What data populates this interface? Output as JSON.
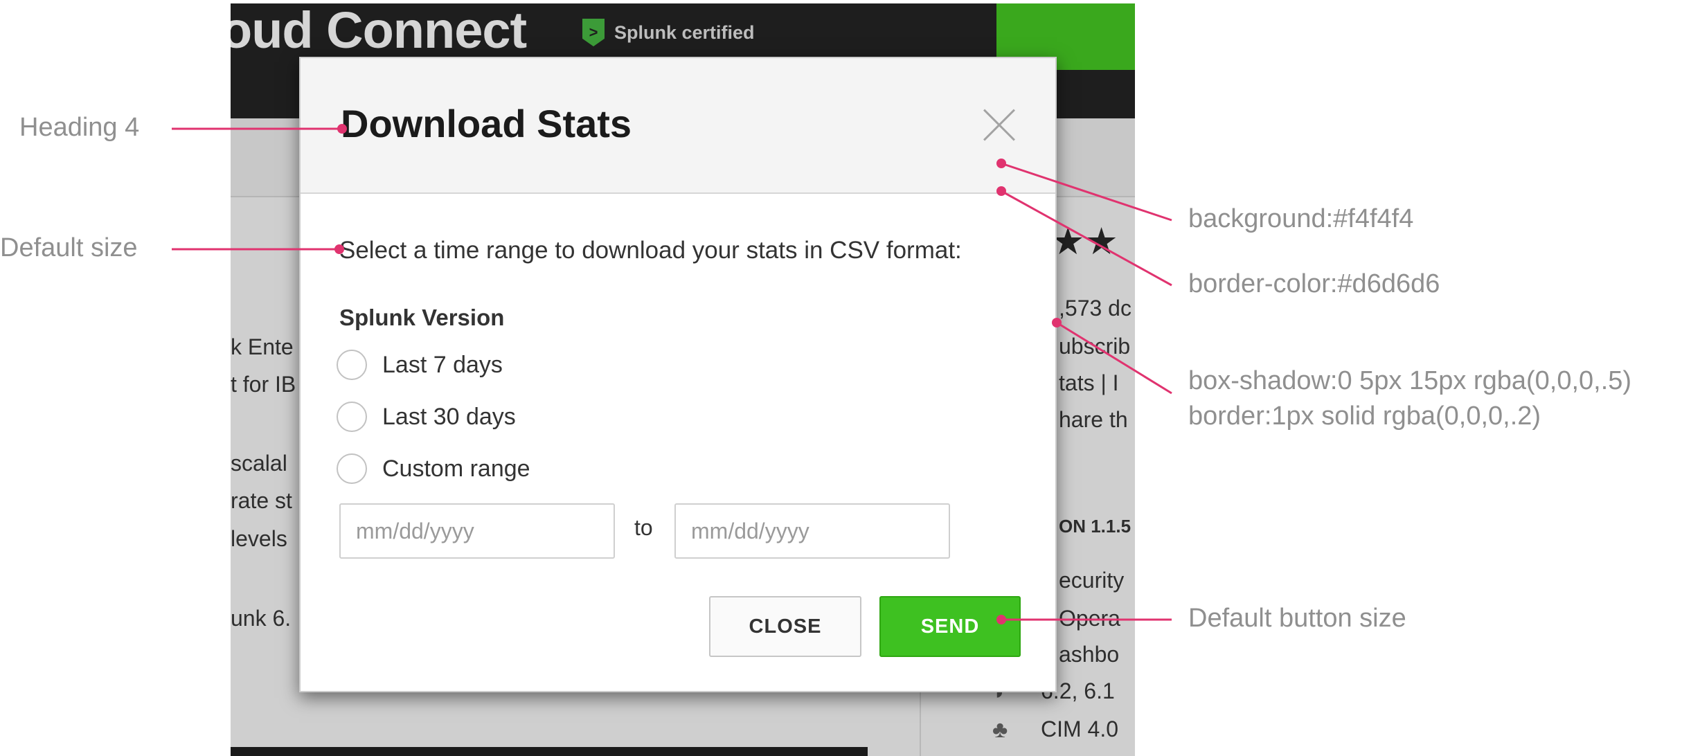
{
  "background_app": {
    "title": "oud Connect",
    "certified_badge": "Splunk certified",
    "certified_icon": "chevron-right-icon",
    "left_snippets": [
      "k Ente",
      "t for IB",
      "scalal",
      "rate st",
      "levels",
      "unk 6."
    ],
    "right_snippets": [
      ",573 dc",
      "ubscrib",
      "tats  |  I",
      "hare th",
      "ON 1.1.5",
      "ecurity",
      "Opera",
      "ashbo",
      "6.2, 6.1",
      "CIM 4.0"
    ],
    "stars": "★★"
  },
  "modal": {
    "title": "Download Stats",
    "close_icon": "close-icon",
    "description": "Select a time range to download your stats in CSV format:",
    "group_label": "Splunk Version",
    "options": [
      {
        "label": "Last 7 days"
      },
      {
        "label": "Last 30 days"
      },
      {
        "label": "Custom range"
      }
    ],
    "date_from_placeholder": "mm/dd/yyyy",
    "to_label": "to",
    "date_to_placeholder": "mm/dd/yyyy",
    "close_button_label": "CLOSE",
    "send_button_label": "SEND"
  },
  "annotations": {
    "heading": "Heading 4",
    "default_size": "Default size",
    "background": "background:#f4f4f4",
    "border_color": "border-color:#d6d6d6",
    "box_shadow": "box-shadow:0 5px 15px rgba(0,0,0,.5)",
    "border": "border:1px solid rgba(0,0,0,.2)",
    "default_button_size": "Default button size"
  },
  "colors": {
    "header_background": "#f4f4f4",
    "header_border": "#d6d6d6",
    "send_button": "#3ec121",
    "annotation_line": "#e0336f",
    "annotation_text": "#8f8f8f"
  }
}
